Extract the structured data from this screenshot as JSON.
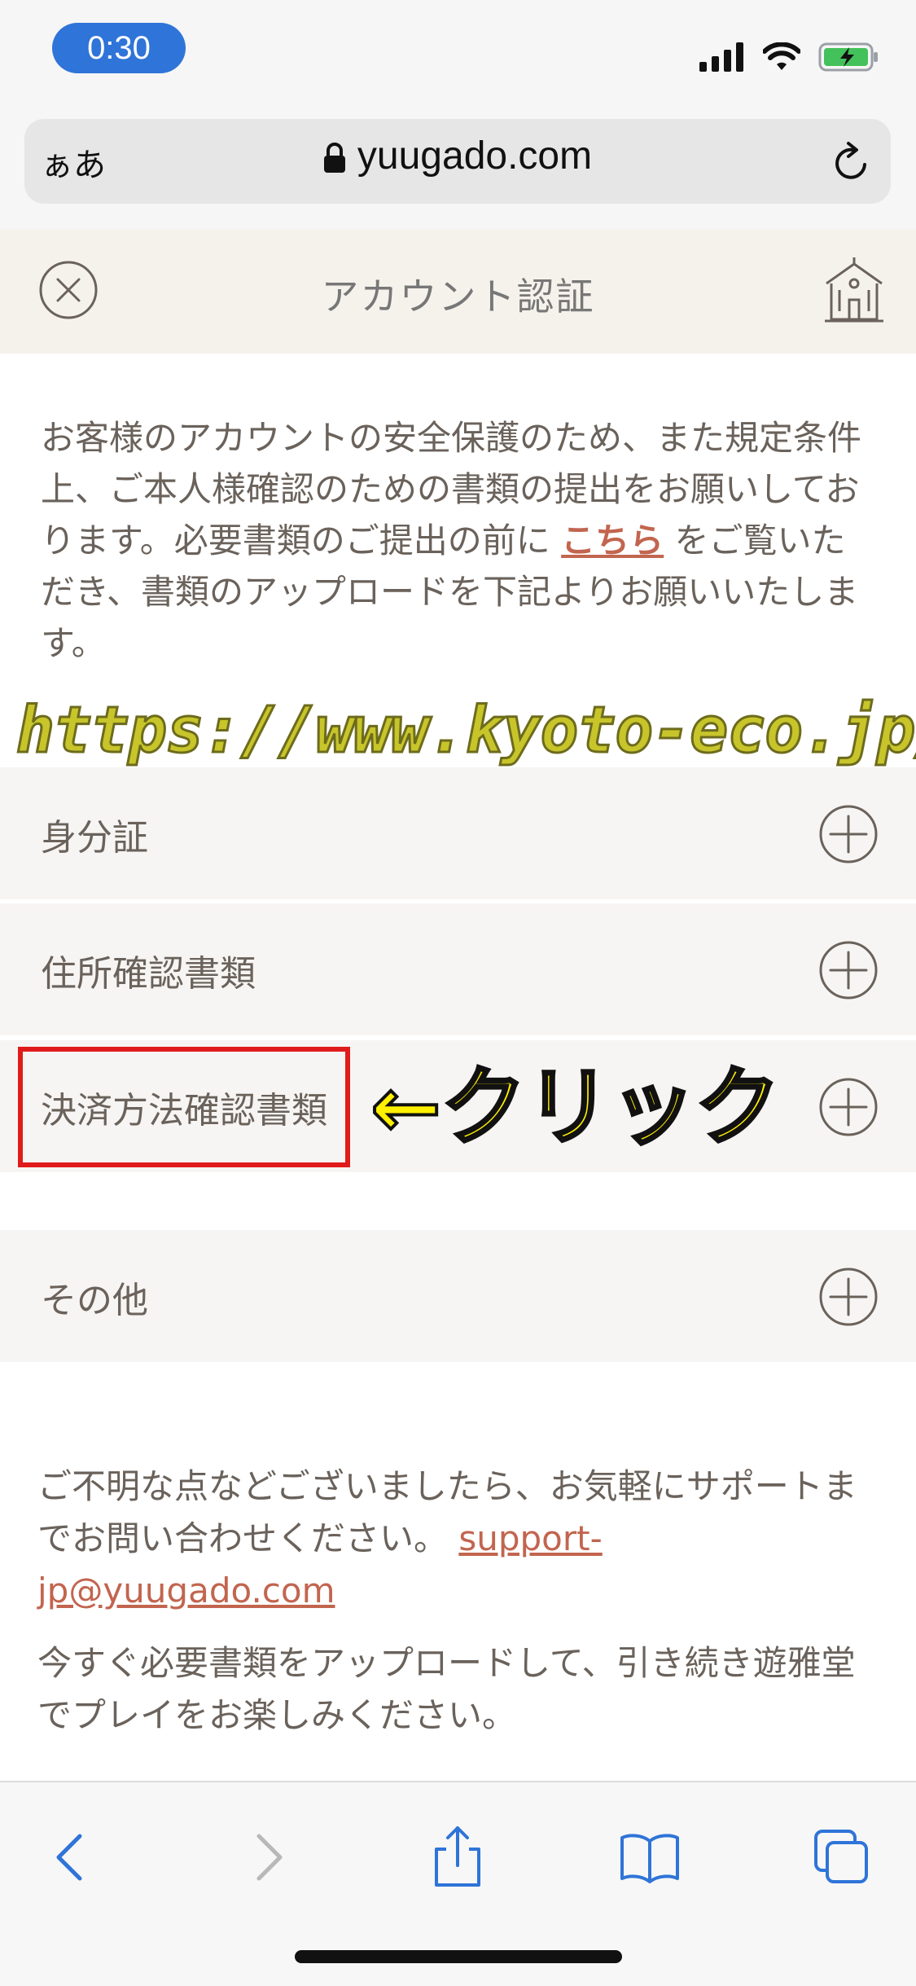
{
  "status_bar": {
    "time": "0:30",
    "icons": [
      "signal-icon",
      "wifi-icon",
      "battery-charging-icon"
    ]
  },
  "url_bar": {
    "text_size_button": "ぁあ",
    "domain": "yuugado.com",
    "icons": [
      "lock-icon",
      "reload-icon"
    ]
  },
  "header": {
    "title": "アカウント認証",
    "icons": [
      "close-icon",
      "home-icon"
    ]
  },
  "intro": {
    "text_before_link": "お客様のアカウントの安全保護のため、また規定条件上、ご本人様確認のための書類の提出をお願いしております。必要書類のご提出の前に ",
    "link": "こちら",
    "text_after_link": " をご覧いただき、書類のアップロードを下記よりお願いいたします。"
  },
  "annotations": {
    "url": "https://www.kyoto-eco.jp/",
    "click": "←クリック"
  },
  "sections": [
    {
      "label": "身分証"
    },
    {
      "label": "住所確認書類"
    },
    {
      "label": "決済方法確認書類"
    },
    {
      "label": "その他"
    }
  ],
  "footer": {
    "support_text": "ご不明な点などございましたら、お気軽にサポートまでお問い合わせください。 ",
    "support_email": "support-jp@yuugado.com",
    "closing_text": "今すぐ必要書類をアップロードして、引き続き遊雅堂でプレイをお楽しみください。"
  },
  "toolbar": {
    "icons": [
      "back-icon",
      "forward-icon",
      "share-icon",
      "bookmarks-icon",
      "tabs-icon"
    ]
  },
  "colors": {
    "accent_link": "#c2654f",
    "ios_blue": "#2f74d8",
    "highlight_red": "#e01b1b",
    "annotation_yellow": "#ffef00"
  }
}
